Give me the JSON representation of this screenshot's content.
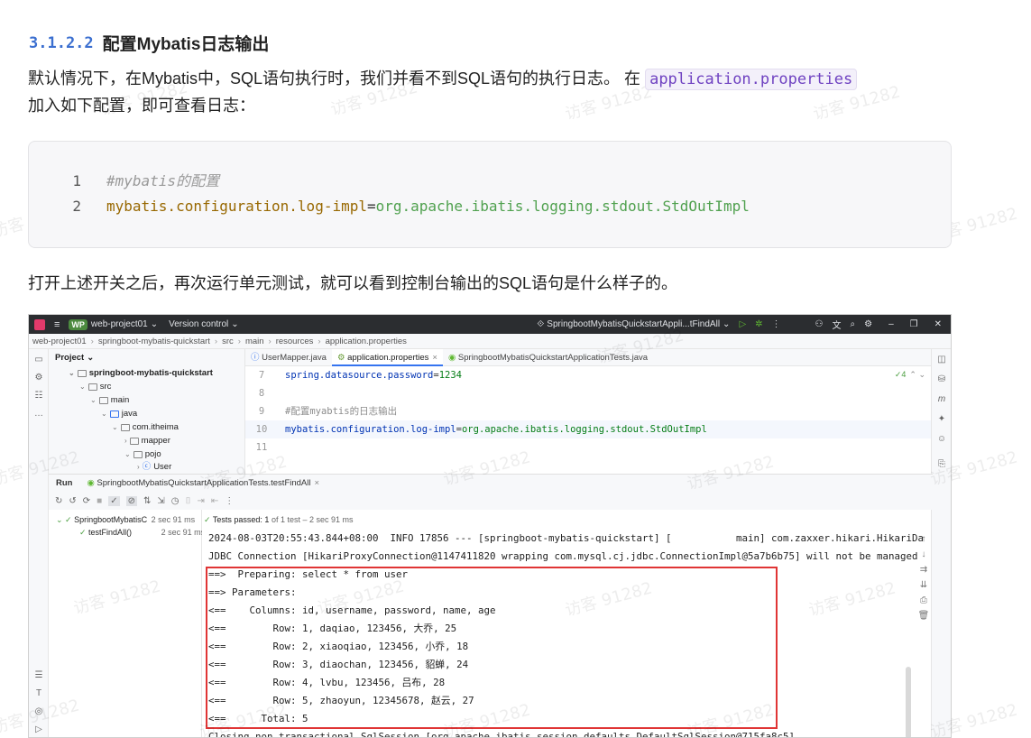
{
  "heading": {
    "number": "3.1.2.2",
    "title": "配置Mybatis日志输出"
  },
  "para1": {
    "text_before": "默认情况下，在Mybatis中，SQL语句执行时，我们并看不到SQL语句的执行日志。 在",
    "code": "application.properties",
    "text_after": "加入如下配置，即可查看日志："
  },
  "codeblock": {
    "lines": [
      {
        "num": "1",
        "comment": "#mybatis的配置"
      },
      {
        "num": "2",
        "key": "mybatis.configuration.log-impl",
        "eq": "=",
        "value": "org.apache.ibatis.logging.stdout.StdOutImpl"
      }
    ]
  },
  "para2": "打开上述开关之后，再次运行单元测试，就可以看到控制台输出的SQL语句是什么样子的。",
  "watermark": "访客 91282",
  "ide": {
    "titlebar": {
      "project_badge": "WP",
      "project": "web-project01",
      "vcs": "Version control",
      "run_config": "SpringbootMybatisQuickstartAppli...tFindAll"
    },
    "breadcrumbs": [
      "web-project01",
      "springboot-mybatis-quickstart",
      "src",
      "main",
      "resources",
      "application.properties"
    ],
    "project_panel_title": "Project",
    "tree": [
      {
        "label": "springboot-mybatis-quickstart",
        "indent": 0,
        "bold": true
      },
      {
        "label": "src",
        "indent": 1
      },
      {
        "label": "main",
        "indent": 2
      },
      {
        "label": "java",
        "indent": 3
      },
      {
        "label": "com.itheima",
        "indent": 4
      },
      {
        "label": "mapper",
        "indent": 5
      },
      {
        "label": "pojo",
        "indent": 5
      },
      {
        "label": "User",
        "indent": 6
      }
    ],
    "editor_tabs": [
      "UserMapper.java",
      "application.properties",
      "SpringbootMybatisQuickstartApplicationTests.java"
    ],
    "editor_lines": [
      {
        "num": "7",
        "key": "spring.datasource.password",
        "eq": "=",
        "value": "1234"
      },
      {
        "num": "8"
      },
      {
        "num": "9",
        "comment": "#配置myabtis的日志输出"
      },
      {
        "num": "10",
        "key": "mybatis.configuration.log-impl",
        "eq": "=",
        "value": "org.apache.ibatis.logging.stdout.StdOutImpl"
      },
      {
        "num": "11"
      }
    ],
    "inspection_count": "4",
    "run_tab_label": "Run",
    "run_config_tab": "SpringbootMybatisQuickstartApplicationTests.testFindAll",
    "test_tree": [
      {
        "label": "SpringbootMybatisC",
        "time": "2 sec 91 ms"
      },
      {
        "label": "testFindAll()",
        "time": "2 sec 91 ms"
      }
    ],
    "tests_passed": "Tests passed: 1",
    "tests_detail": "of 1 test – 2 sec 91 ms",
    "console_lines": [
      "2024-08-03T20:55:43.844+08:00  INFO 17856 --- [springboot-mybatis-quickstart] [           main] com.zaxxer.hikari.HikariDa",
      "JDBC Connection [HikariProxyConnection@1147411820 wrapping com.mysql.cj.jdbc.ConnectionImpl@5a7b6b75] will not be managed",
      "==>  Preparing: select * from user",
      "==> Parameters: ",
      "<==    Columns: id, username, password, name, age",
      "<==        Row: 1, daqiao, 123456, 大乔, 25",
      "<==        Row: 2, xiaoqiao, 123456, 小乔, 18",
      "<==        Row: 3, diaochan, 123456, 貂蝉, 24",
      "<==        Row: 4, lvbu, 123456, 吕布, 28",
      "<==        Row: 5, zhaoyun, 12345678, 赵云, 27",
      "<==      Total: 5",
      "Closing non transactional SqlSession [org.apache.ibatis.session.defaults.DefaultSqlSession@715fa8c5]"
    ]
  }
}
